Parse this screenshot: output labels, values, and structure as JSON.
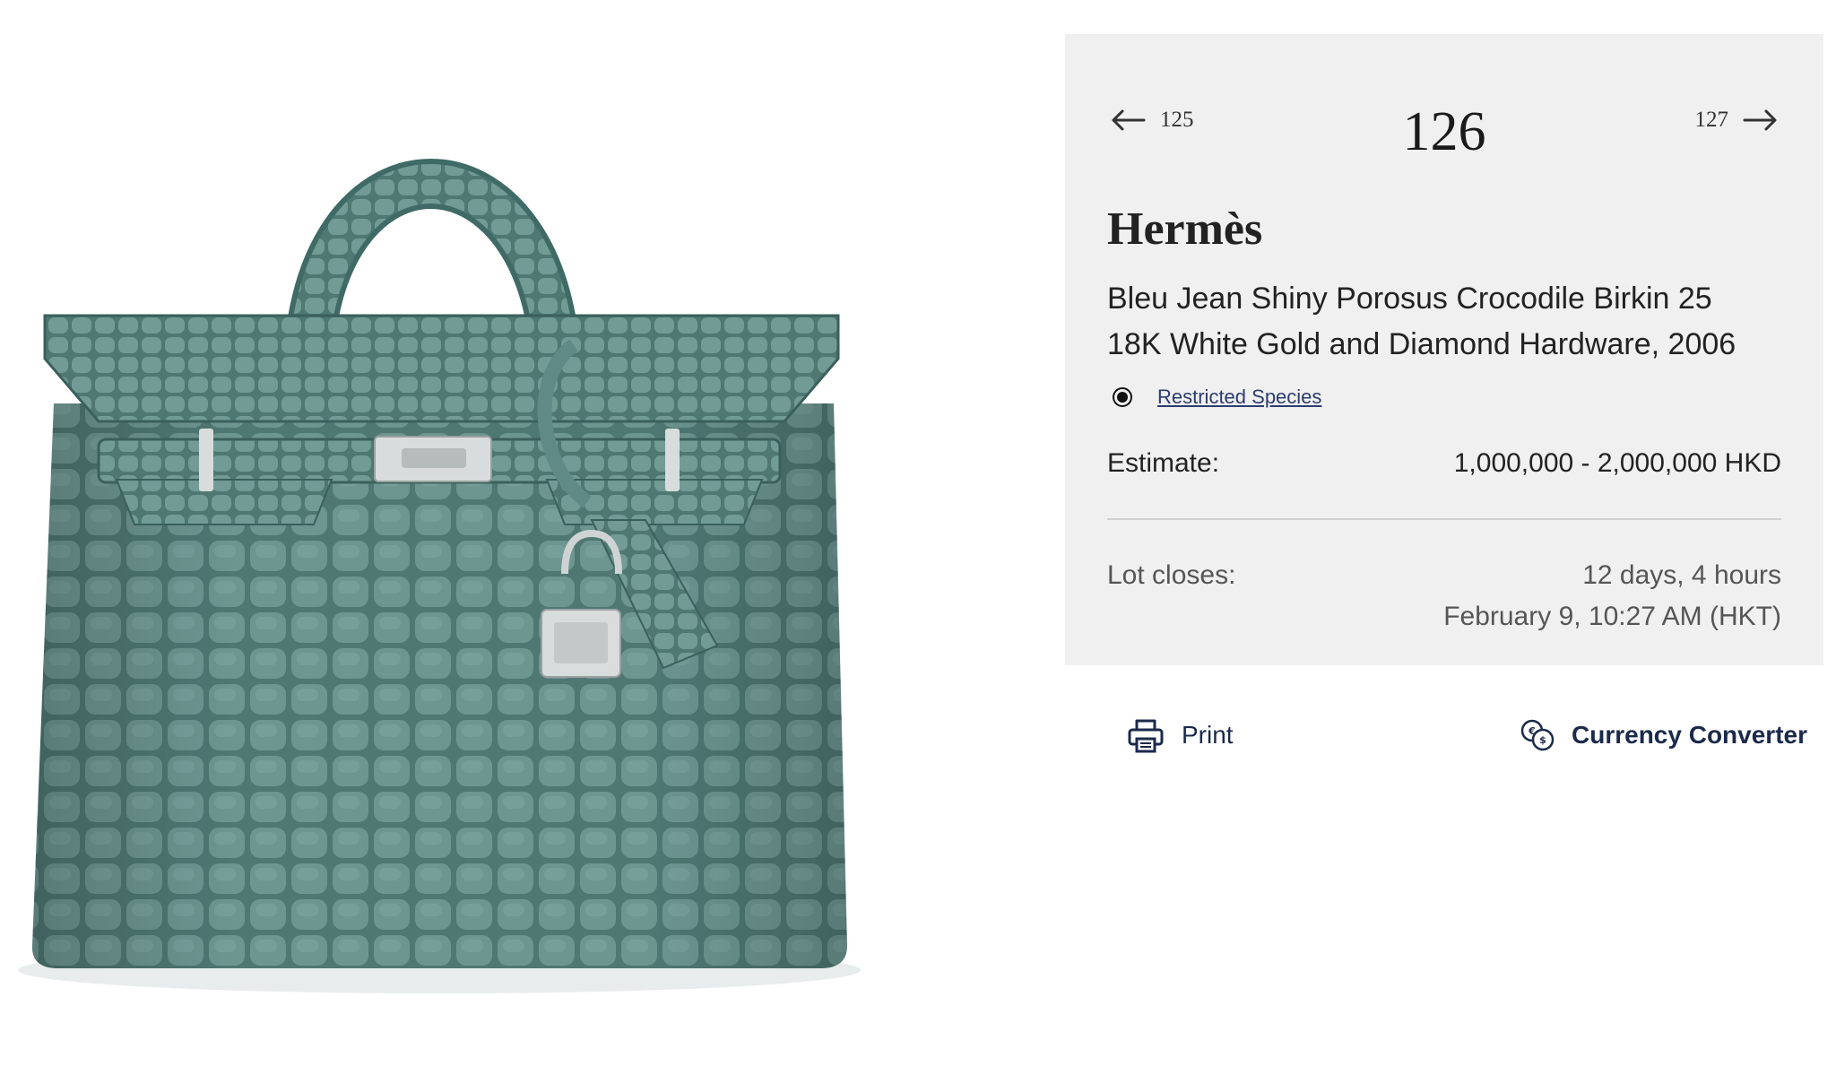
{
  "navigation": {
    "prev_lot": "125",
    "current_lot": "126",
    "next_lot": "127"
  },
  "lot": {
    "maker": "Hermès",
    "title_line1": "Bleu Jean Shiny Porosus Crocodile Birkin 25",
    "title_line2": "18K White Gold and Diamond Hardware, 2006",
    "species_link": "Restricted Species",
    "estimate_label": "Estimate:",
    "estimate_value": "1,000,000 - 2,000,000 HKD",
    "closes_label": "Lot closes:",
    "closes_remaining": "12 days, 4 hours",
    "closes_datetime": "February 9, 10:27 AM (HKT)"
  },
  "actions": {
    "print_label": "Print",
    "currency_label": "Currency Converter"
  },
  "colors": {
    "panel_bg": "#f0f0f0",
    "link_blue": "#2c3c6e",
    "action_navy": "#1b2a4a",
    "bag_green": "#5f8a85"
  },
  "icons": [
    "arrow-left-icon",
    "arrow-right-icon",
    "radio-selected-icon",
    "printer-icon",
    "currency-exchange-icon"
  ]
}
